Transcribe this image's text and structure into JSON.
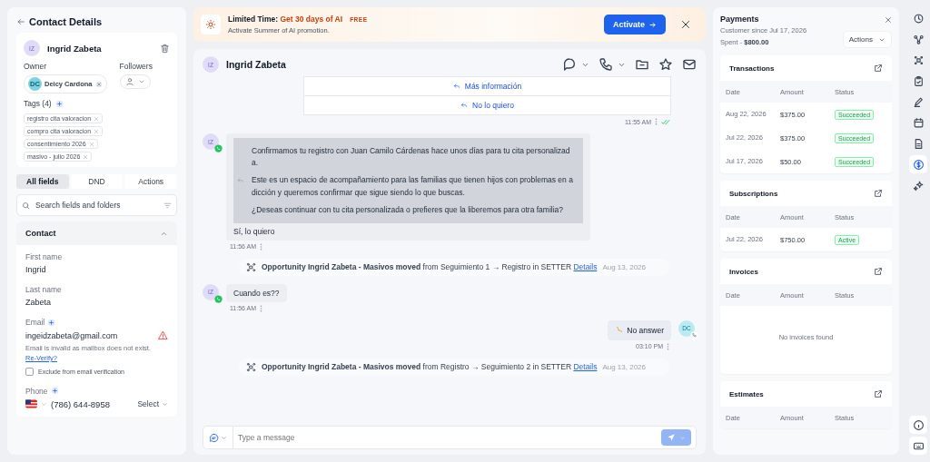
{
  "contact_panel": {
    "title": "Contact Details",
    "contact": {
      "initials": "IZ",
      "name": "Ingrid Zabeta"
    },
    "owner": {
      "label": "Owner",
      "initials": "DC",
      "name": "Deicy Cardona"
    },
    "followers": {
      "label": "Followers"
    },
    "tags": {
      "label": "Tags (4)",
      "items": [
        "registro cita valoracion",
        "compro cita valoracion",
        "consentimiento 2026",
        "masivo - julio 2026"
      ]
    },
    "tabs": [
      {
        "label": "All fields",
        "selected": true
      },
      {
        "label": "DND",
        "selected": false
      },
      {
        "label": "Actions",
        "selected": false
      }
    ],
    "search": {
      "placeholder": "Search fields and folders"
    },
    "section": {
      "title": "Contact",
      "expanded": true
    },
    "fields": [
      {
        "kind": "text",
        "label": "First name",
        "value": "Ingrid"
      },
      {
        "kind": "text",
        "label": "Last name",
        "value": "Zabeta"
      },
      {
        "kind": "email",
        "label": "Email",
        "value": "ingeidzabeta@gmail.com",
        "error": "Email is invalid as mailbox does not exist.",
        "link": "Re-Verify?",
        "checkbox": {
          "label": "Exclude from email verification",
          "checked": false
        }
      },
      {
        "kind": "phone",
        "label": "Phone",
        "value": "(786) 644-8958",
        "type": "Select"
      }
    ]
  },
  "promo": {
    "title": "Limited Time:",
    "highlight": "Get 30 days of AI",
    "badge": "FREE",
    "subtitle": "Activate Summer of AI promotion.",
    "button": "Activate"
  },
  "conversation": {
    "contact": {
      "initials": "IZ",
      "name": "Ingrid Zabeta"
    },
    "messages": [
      {
        "kind": "options",
        "options": [
          "Más información",
          "No lo quiero"
        ],
        "time": "11:55 AM",
        "read": true
      },
      {
        "kind": "incoming",
        "initials": "IZ",
        "whatsapp": true,
        "quote": [
          "Confirmamos tu registro con Juan Camilo Cárdenas hace unos días para tu cita personalizada.",
          "Este es un espacio de acompañamiento para las familias que tienen hijos con problemas en adicción y queremos confirmar que sigue siendo lo que buscas.",
          "¿Deseas continuar con tu cita personalizada o prefieres que la liberemos para otra familia?"
        ],
        "text": "Sí, lo quiero",
        "time": "11:56 AM"
      },
      {
        "kind": "event",
        "text": "**Opportunity Ingrid Zabeta - Masivos moved** from Seguimiento 1 → Registro in SETTER",
        "link": "Details",
        "date": "Aug 13, 2026"
      },
      {
        "kind": "incoming",
        "initials": "IZ",
        "whatsapp": true,
        "text": "Cuando es??",
        "time": "11:56 AM"
      },
      {
        "kind": "call",
        "initials": "DC",
        "text": "No answer",
        "time": "03:10 PM"
      },
      {
        "kind": "event",
        "text": "**Opportunity Ingrid Zabeta - Masivos moved** from Registro → Seguimiento 2 in SETTER",
        "link": "Details",
        "date": "Aug 13, 2026"
      }
    ],
    "composer": {
      "placeholder": "Type a message"
    }
  },
  "payments": {
    "title": "Payments",
    "since": "Customer since Jul 17, 2026",
    "spent_label": "Spent -",
    "spent": "$800.00",
    "actions": "Actions",
    "cards": [
      {
        "title": "Transactions",
        "columns": [
          "Date",
          "Amount",
          "Status"
        ],
        "rows": [
          {
            "date": "Aug 22, 2026",
            "amount": "$375.00",
            "status": "Succeeded"
          },
          {
            "date": "Jul 22, 2026",
            "amount": "$375.00",
            "status": "Succeeded"
          },
          {
            "date": "Jul 17, 2026",
            "amount": "$50.00",
            "status": "Succeeded"
          }
        ]
      },
      {
        "title": "Subscriptions",
        "columns": [
          "Date",
          "Amount",
          "Status"
        ],
        "rows": [
          {
            "date": "Jul 22, 2026",
            "amount": "$750.00",
            "status": "Active"
          }
        ]
      },
      {
        "title": "Invoices",
        "columns": [
          "Date",
          "Amount",
          "Status"
        ],
        "empty": "No invoices found"
      },
      {
        "title": "Estimates",
        "columns": [
          "Date",
          "Amount",
          "Status"
        ]
      }
    ]
  },
  "rail": {
    "items": [
      {
        "selected": false
      },
      {
        "selected": false
      },
      {
        "selected": false
      },
      {
        "selected": false
      },
      {
        "selected": false
      },
      {
        "selected": false
      },
      {
        "selected": false
      },
      {
        "selected": true
      },
      {
        "selected": false
      }
    ]
  }
}
